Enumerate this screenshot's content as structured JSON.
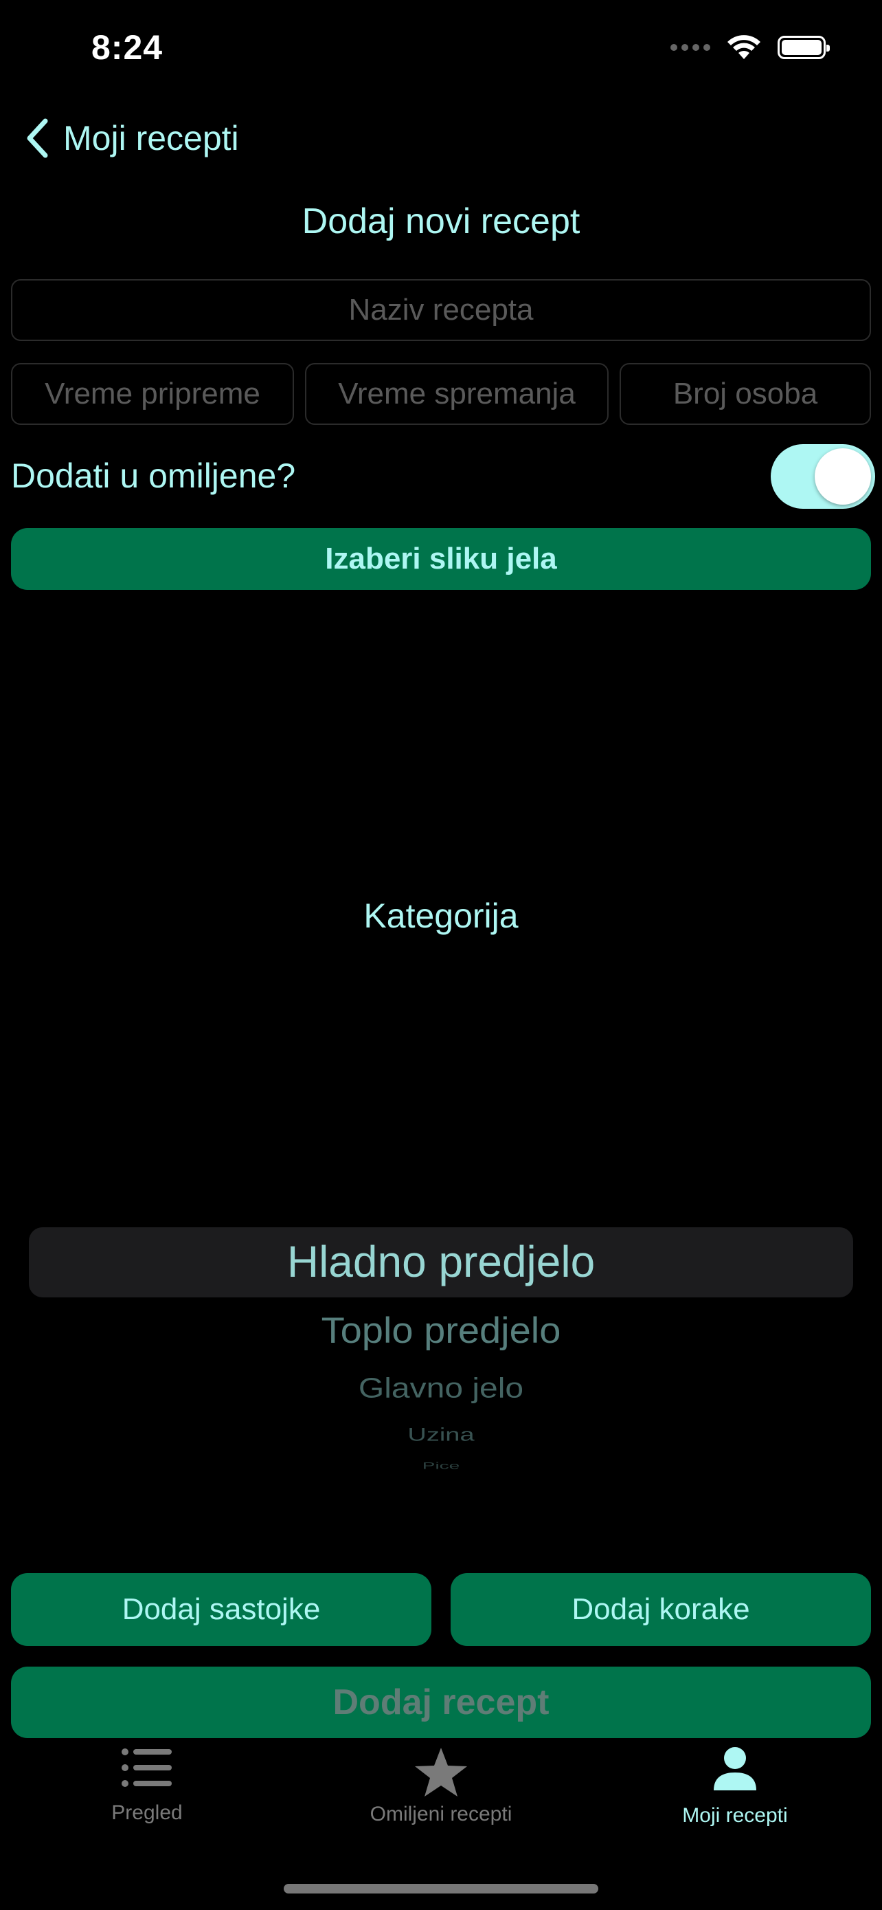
{
  "status": {
    "time": "8:24"
  },
  "nav": {
    "back_label": "Moji recepti",
    "title": "Dodaj novi recept"
  },
  "form": {
    "name_placeholder": "Naziv recepta",
    "prep_placeholder": "Vreme pripreme",
    "cook_placeholder": "Vreme spremanja",
    "servings_placeholder": "Broj osoba",
    "favorite_label": "Dodati u omiljene?",
    "favorite_on": true,
    "pick_image_label": "Izaberi sliku jela"
  },
  "category": {
    "label": "Kategorija",
    "options": [
      "Hladno predjelo",
      "Toplo predjelo",
      "Glavno jelo",
      "Uzina",
      "Pice"
    ],
    "selected": "Hladno predjelo"
  },
  "actions": {
    "add_ingredients": "Dodaj sastojke",
    "add_steps": "Dodaj korake",
    "add_recipe": "Dodaj recept"
  },
  "tabs": [
    {
      "label": "Pregled",
      "icon": "list-icon",
      "active": false
    },
    {
      "label": "Omiljeni recepti",
      "icon": "star-icon",
      "active": false
    },
    {
      "label": "Moji recepti",
      "icon": "person-icon",
      "active": true
    }
  ],
  "colors": {
    "accent": "#aef7f3",
    "button_green": "#00744b",
    "background": "#000000"
  }
}
